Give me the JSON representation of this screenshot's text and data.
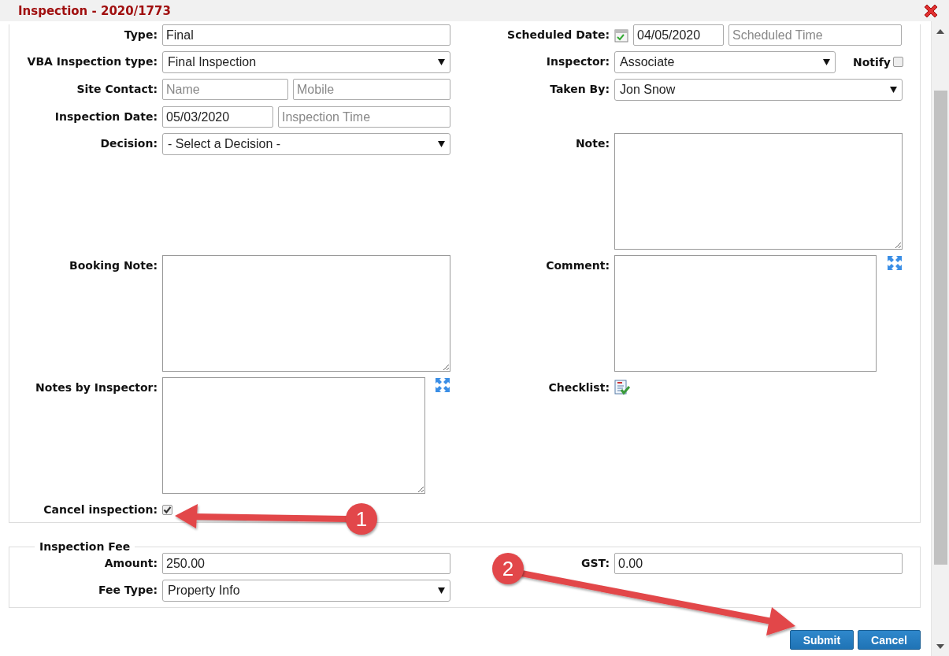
{
  "dialog": {
    "title": "Inspection - 2020/1773"
  },
  "form": {
    "type": {
      "label": "Type:",
      "value": "Final"
    },
    "scheduled_date": {
      "label": "Scheduled Date:",
      "date": "04/05/2020",
      "time_placeholder": "Scheduled Time"
    },
    "vba_type": {
      "label": "VBA Inspection type:",
      "value": "Final Inspection"
    },
    "inspector": {
      "label": "Inspector:",
      "value": "Associate"
    },
    "notify": {
      "label": "Notify",
      "checked": false
    },
    "site_contact": {
      "label": "Site Contact:",
      "name_placeholder": "Name",
      "mobile_placeholder": "Mobile"
    },
    "taken_by": {
      "label": "Taken By:",
      "value": "Jon Snow"
    },
    "inspection_date": {
      "label": "Inspection Date:",
      "date": "05/03/2020",
      "time_placeholder": "Inspection Time"
    },
    "decision": {
      "label": "Decision:",
      "value": "- Select a Decision -"
    },
    "note": {
      "label": "Note:"
    },
    "booking_note": {
      "label": "Booking Note:"
    },
    "comment": {
      "label": "Comment:"
    },
    "notes_by_inspector": {
      "label": "Notes by Inspector:"
    },
    "checklist": {
      "label": "Checklist:"
    },
    "cancel_inspection": {
      "label": "Cancel inspection:",
      "checked": true
    }
  },
  "fee": {
    "legend": "Inspection Fee",
    "amount": {
      "label": "Amount:",
      "value": "250.00"
    },
    "gst": {
      "label": "GST:",
      "value": "0.00"
    },
    "fee_type": {
      "label": "Fee Type:",
      "value": "Property Info"
    }
  },
  "buttons": [
    {
      "label": "Submit"
    },
    {
      "label": "Cancel"
    }
  ],
  "annotations": [
    {
      "label": "1"
    },
    {
      "label": "2"
    }
  ]
}
